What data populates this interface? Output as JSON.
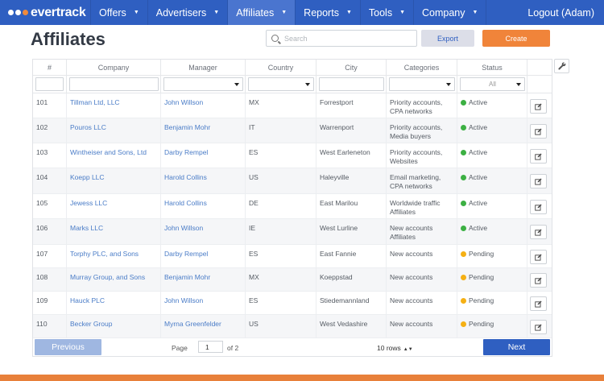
{
  "app": {
    "brand": "evertrack"
  },
  "nav": {
    "items": [
      {
        "label": "Offers",
        "active": false
      },
      {
        "label": "Advertisers",
        "active": false
      },
      {
        "label": "Affiliates",
        "active": true
      },
      {
        "label": "Reports",
        "active": false
      },
      {
        "label": "Tools",
        "active": false
      },
      {
        "label": "Company",
        "active": false
      }
    ],
    "logout_label": "Logout (Adam)"
  },
  "header": {
    "title": "Affiliates",
    "search_placeholder": "Search",
    "export_label": "Export",
    "create_label": "Create"
  },
  "table": {
    "columns": [
      "#",
      "Company",
      "Manager",
      "Country",
      "City",
      "Categories",
      "Status"
    ],
    "status_filter": "All",
    "rows": [
      {
        "id": "101",
        "company": "Tillman Ltd, LLC",
        "manager": "John Willson",
        "country": "MX",
        "city": "Forrestport",
        "cat1": "Priority accounts,",
        "cat2": "CPA networks",
        "status": "Active"
      },
      {
        "id": "102",
        "company": "Pouros LLC",
        "manager": "Benjamin Mohr",
        "country": "IT",
        "city": "Warrenport",
        "cat1": "Priority accounts,",
        "cat2": "Media buyers",
        "status": "Active"
      },
      {
        "id": "103",
        "company": "Wintheiser and Sons, Ltd",
        "manager": "Darby Rempel",
        "country": "ES",
        "city": "West Earleneton",
        "cat1": "Priority accounts,",
        "cat2": "Websites",
        "status": "Active"
      },
      {
        "id": "104",
        "company": "Koepp LLC",
        "manager": "Harold Collins",
        "country": "US",
        "city": "Haleyville",
        "cat1": "Email marketing,",
        "cat2": "CPA networks",
        "status": "Active"
      },
      {
        "id": "105",
        "company": "Jewess LLC",
        "manager": "Harold Collins",
        "country": "DE",
        "city": "East Marilou",
        "cat1": "Worldwide traffic",
        "cat2": "Affiliates",
        "status": "Active"
      },
      {
        "id": "106",
        "company": "Marks LLC",
        "manager": "John Willson",
        "country": "IE",
        "city": "West Lurline",
        "cat1": "New accounts",
        "cat2": "Affiliates",
        "status": "Active"
      },
      {
        "id": "107",
        "company": "Torphy PLC, and Sons",
        "manager": "Darby Rempel",
        "country": "ES",
        "city": "East Fannie",
        "cat1": "New accounts",
        "cat2": "",
        "status": "Pending"
      },
      {
        "id": "108",
        "company": "Murray Group, and Sons",
        "manager": "Benjamin Mohr",
        "country": "MX",
        "city": "Koeppstad",
        "cat1": "New accounts",
        "cat2": "",
        "status": "Pending"
      },
      {
        "id": "109",
        "company": "Hauck PLC",
        "manager": "John Willson",
        "country": "ES",
        "city": "Stiedemannland",
        "cat1": "New accounts",
        "cat2": "",
        "status": "Pending"
      },
      {
        "id": "110",
        "company": "Becker Group",
        "manager": "Myrna Greenfelder",
        "country": "US",
        "city": "West Vedashire",
        "cat1": "New accounts",
        "cat2": "",
        "status": "Pending"
      }
    ]
  },
  "pager": {
    "prev_label": "Previous",
    "next_label": "Next",
    "page_label": "Page",
    "current_page": "1",
    "of_label": "of 2",
    "rows_label": "10 rows"
  },
  "colors": {
    "primary": "#2f5fc1",
    "accent": "#f0843a",
    "active": "#3cb043",
    "pending": "#f5b014"
  }
}
